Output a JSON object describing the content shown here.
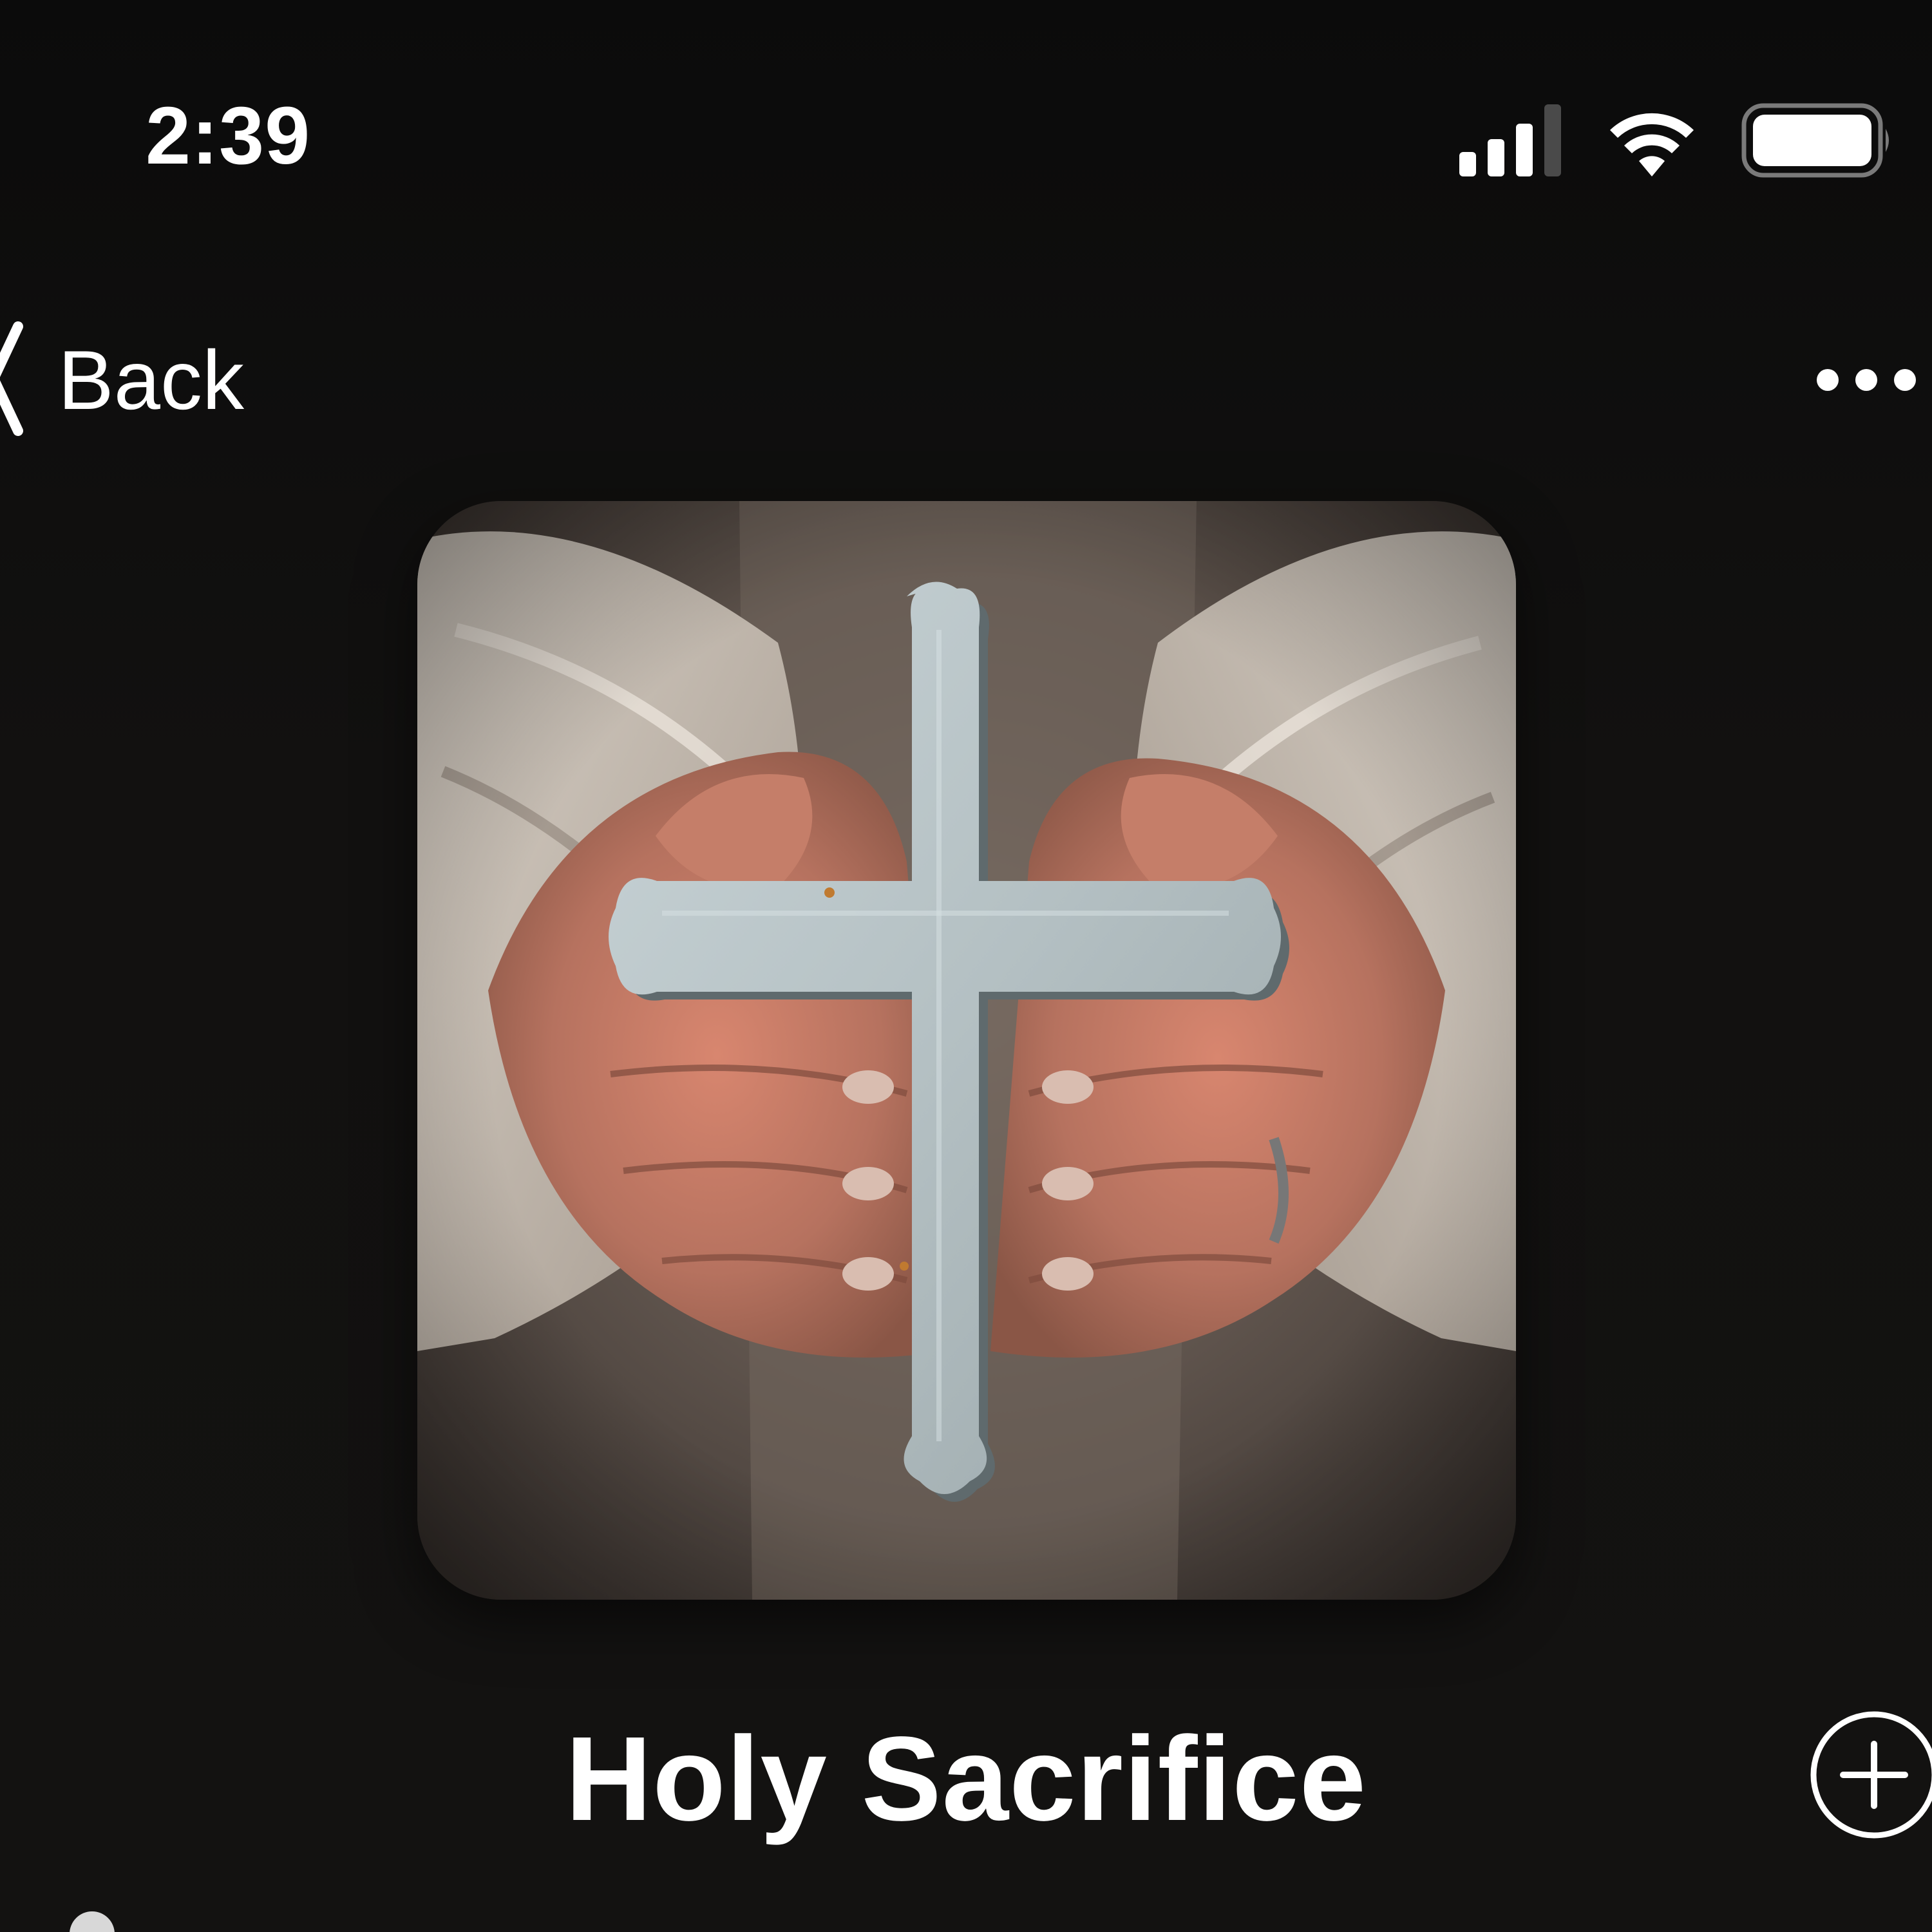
{
  "status_bar": {
    "time": "2:39",
    "icons": [
      "cellular-signal-icon",
      "wifi-icon",
      "battery-icon"
    ]
  },
  "nav": {
    "back_label": "Back",
    "back_icon": "chevron-left-icon",
    "more_icon": "ellipsis-icon"
  },
  "playlist": {
    "title": "Holy Sacrifice",
    "artwork_icon": "cross-artwork",
    "add_icon": "plus-circle-icon"
  },
  "colors": {
    "background": "#121110",
    "text": "#ffffff"
  }
}
